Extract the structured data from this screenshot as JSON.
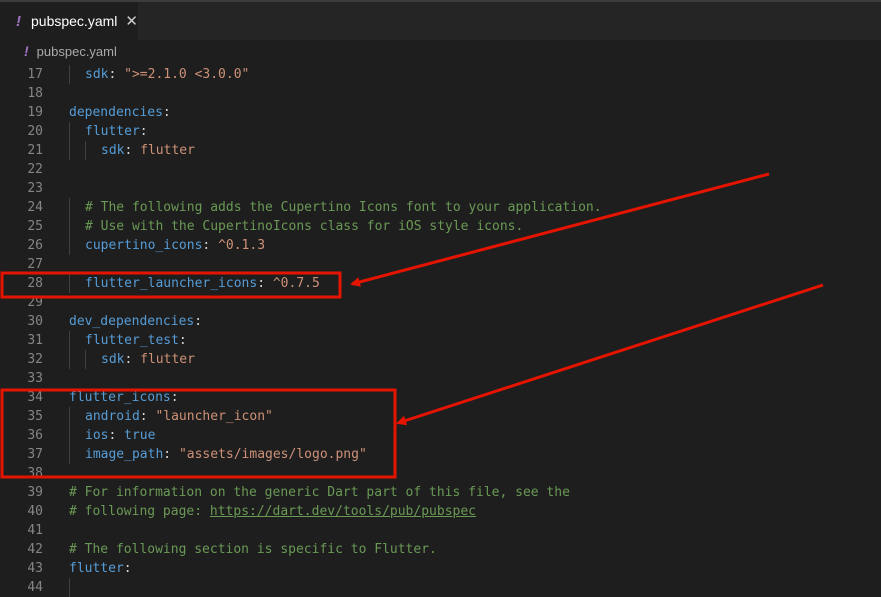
{
  "tab": {
    "icon": "!",
    "label": "pubspec.yaml",
    "close": "✕"
  },
  "breadcrumb": {
    "icon": "!",
    "label": "pubspec.yaml"
  },
  "lines": [
    {
      "n": "17",
      "indent": 1,
      "tokens": [
        [
          "key",
          "sdk"
        ],
        [
          "punc",
          ": "
        ],
        [
          "str",
          "\">=2.1.0 <3.0.0\""
        ]
      ]
    },
    {
      "n": "18",
      "indent": 0,
      "tokens": []
    },
    {
      "n": "19",
      "indent": 0,
      "tokens": [
        [
          "key",
          "dependencies"
        ],
        [
          "punc",
          ":"
        ]
      ]
    },
    {
      "n": "20",
      "indent": 1,
      "tokens": [
        [
          "key",
          "flutter"
        ],
        [
          "punc",
          ":"
        ]
      ]
    },
    {
      "n": "21",
      "indent": 2,
      "tokens": [
        [
          "key",
          "sdk"
        ],
        [
          "punc",
          ": "
        ],
        [
          "str",
          "flutter"
        ]
      ]
    },
    {
      "n": "22",
      "indent": 0,
      "tokens": []
    },
    {
      "n": "23",
      "indent": 0,
      "tokens": []
    },
    {
      "n": "24",
      "indent": 1,
      "tokens": [
        [
          "com",
          "# The following adds the Cupertino Icons font to your application."
        ]
      ]
    },
    {
      "n": "25",
      "indent": 1,
      "tokens": [
        [
          "com",
          "# Use with the CupertinoIcons class for iOS style icons."
        ]
      ]
    },
    {
      "n": "26",
      "indent": 1,
      "tokens": [
        [
          "key",
          "cupertino_icons"
        ],
        [
          "punc",
          ": "
        ],
        [
          "str",
          "^0.1.3"
        ]
      ]
    },
    {
      "n": "27",
      "indent": 0,
      "tokens": []
    },
    {
      "n": "28",
      "indent": 1,
      "tokens": [
        [
          "key",
          "flutter_launcher_icons"
        ],
        [
          "punc",
          ": "
        ],
        [
          "str",
          "^0.7.5"
        ]
      ]
    },
    {
      "n": "29",
      "indent": 0,
      "tokens": []
    },
    {
      "n": "30",
      "indent": 0,
      "tokens": [
        [
          "key",
          "dev_dependencies"
        ],
        [
          "punc",
          ":"
        ]
      ]
    },
    {
      "n": "31",
      "indent": 1,
      "tokens": [
        [
          "key",
          "flutter_test"
        ],
        [
          "punc",
          ":"
        ]
      ]
    },
    {
      "n": "32",
      "indent": 2,
      "tokens": [
        [
          "key",
          "sdk"
        ],
        [
          "punc",
          ": "
        ],
        [
          "str",
          "flutter"
        ]
      ]
    },
    {
      "n": "33",
      "indent": 0,
      "tokens": []
    },
    {
      "n": "34",
      "indent": 0,
      "tokens": [
        [
          "key",
          "flutter_icons"
        ],
        [
          "punc",
          ":"
        ]
      ]
    },
    {
      "n": "35",
      "indent": 1,
      "tokens": [
        [
          "key",
          "android"
        ],
        [
          "punc",
          ": "
        ],
        [
          "str",
          "\"launcher_icon\""
        ]
      ]
    },
    {
      "n": "36",
      "indent": 1,
      "tokens": [
        [
          "key",
          "ios"
        ],
        [
          "punc",
          ": "
        ],
        [
          "key",
          "true"
        ]
      ]
    },
    {
      "n": "37",
      "indent": 1,
      "tokens": [
        [
          "key",
          "image_path"
        ],
        [
          "punc",
          ": "
        ],
        [
          "str",
          "\"assets/images/logo.png\""
        ]
      ]
    },
    {
      "n": "38",
      "indent": 0,
      "tokens": []
    },
    {
      "n": "39",
      "indent": 0,
      "tokens": [
        [
          "com",
          "# For information on the generic Dart part of this file, see the"
        ]
      ]
    },
    {
      "n": "40",
      "indent": 0,
      "tokens": [
        [
          "com",
          "# following page: "
        ],
        [
          "link",
          "https://dart.dev/tools/pub/pubspec"
        ]
      ]
    },
    {
      "n": "41",
      "indent": 0,
      "tokens": []
    },
    {
      "n": "42",
      "indent": 0,
      "tokens": [
        [
          "com",
          "# The following section is specific to Flutter."
        ]
      ]
    },
    {
      "n": "43",
      "indent": 0,
      "tokens": [
        [
          "key",
          "flutter"
        ],
        [
          "punc",
          ":"
        ]
      ]
    },
    {
      "n": "44",
      "indent": 1,
      "tokens": []
    }
  ],
  "annotation_color": "#e51400"
}
